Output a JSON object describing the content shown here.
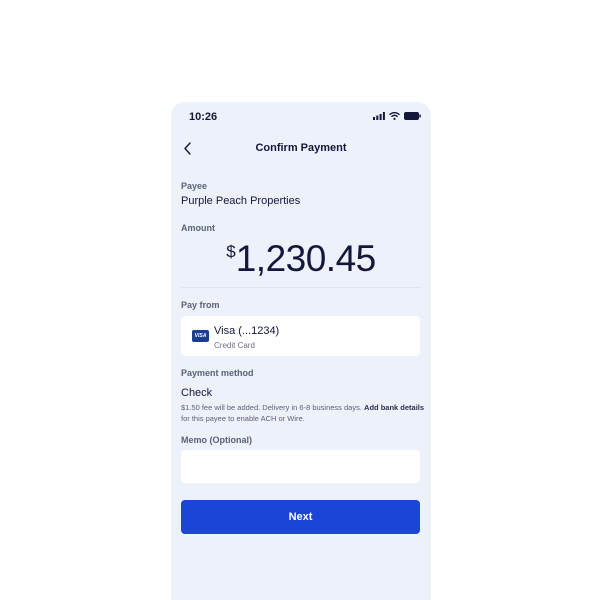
{
  "status_bar": {
    "time": "10:26",
    "icons": [
      "signal-icon",
      "wifi-icon",
      "battery-icon"
    ]
  },
  "header": {
    "back_icon": "chevron-left-icon",
    "title": "Confirm Payment"
  },
  "payee": {
    "label": "Payee",
    "value": "Purple Peach Properties"
  },
  "amount": {
    "label": "Amount",
    "currency": "$",
    "value": "1,230.45"
  },
  "pay_from": {
    "label": "Pay from",
    "card_brand": "VISA",
    "card_name": "Visa (...1234)",
    "card_type": "Credit Card"
  },
  "payment_method": {
    "label": "Payment method",
    "value": "Check",
    "note_prefix": "$1.50 fee will be added. Delivery in 6-8 business days. ",
    "note_link": "Add bank details",
    "note_suffix": " for this payee to enable ACH or Wire."
  },
  "memo": {
    "label": "Memo (Optional)",
    "value": "",
    "placeholder": ""
  },
  "actions": {
    "next_label": "Next"
  },
  "colors": {
    "background": "#edf1fa",
    "primary": "#1b45d6",
    "text": "#14163a",
    "visa": "#1a3f8f"
  }
}
